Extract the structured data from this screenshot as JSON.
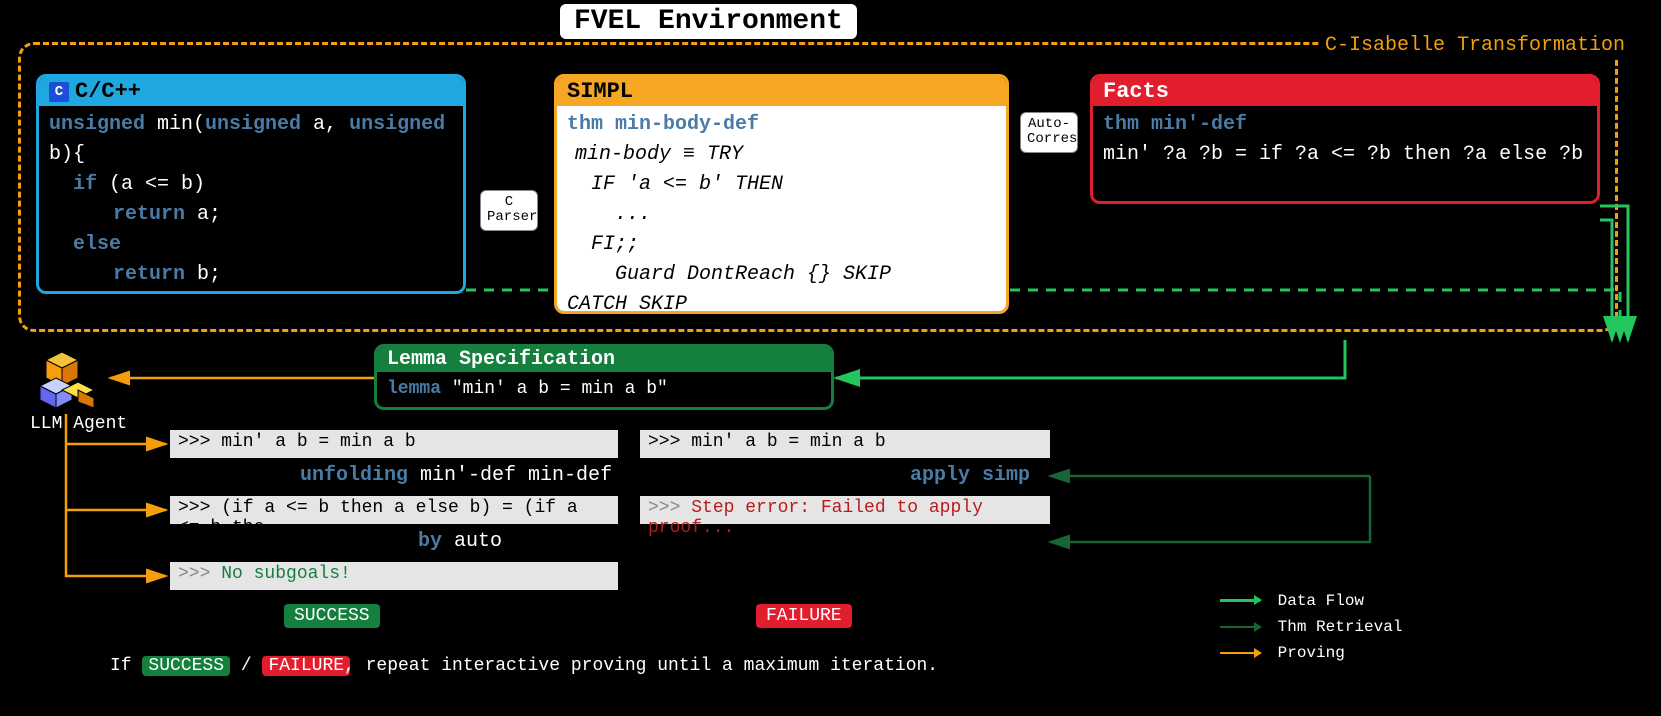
{
  "title": "FVEL Environment",
  "env_label": "C-Isabelle Transformation",
  "panels": {
    "ccpp": {
      "title": "C/C++",
      "line1_lead": "unsigned",
      "line1_sig": " min(",
      "line1_k2": "unsigned",
      "line1_mid": " a, ",
      "line1_k3": "unsigned",
      "line1_end": " b){",
      "line2_kw": "if",
      "line2_rest": " (a <= b)",
      "line3_kw": "return",
      "line3_rest": " a;",
      "line4_kw": "else",
      "line5_kw": "return",
      "line5_rest": " b;"
    },
    "simpl": {
      "title": "SIMPL",
      "line_thm": "thm min-body-def",
      "l1": "min-body ≡ TRY",
      "l2": "IF 'a <= b' THEN",
      "l3": "...",
      "l4": "FI;;",
      "l5": "Guard DontReach {} SKIP",
      "l6": "CATCH SKIP"
    },
    "facts": {
      "title": "Facts",
      "line_thm": "thm min'-def",
      "body": "min' ?a ?b = if ?a <= ?b then ?a else ?b"
    },
    "lemma": {
      "title": "Lemma Specification",
      "kw": "lemma",
      "body": "\"min' a b = min a b\""
    }
  },
  "labels": {
    "parser": "C\nParser",
    "auto": "Auto-\nCorres",
    "llm": "LLM Agent"
  },
  "trace": {
    "left": {
      "r1": ">>> min' a b = min a b",
      "step1": "unfolding",
      "step1_rest": " min'-def min-def",
      "r2": ">>> (if a <= b then a else b) = (if a <= b the...",
      "step2": "by",
      "step2_rest": " auto",
      "r3_prefix": ">>> ",
      "r3_ok": "No subgoals!",
      "badge": "SUCCESS"
    },
    "right": {
      "r1": ">>> min' a b = min a b",
      "step1": "apply simp",
      "r2_prefix": ">>> ",
      "r2_err": "Step error: Failed to apply proof...",
      "badge": "FAILURE"
    }
  },
  "legend": {
    "a": "Data Flow",
    "b": "Thm Retrieval",
    "c": "Proving"
  },
  "footer": {
    "note_lead": "If ",
    "succ": "SUCCESS",
    "fail": "FAILURE",
    "note_tail": ", repeat interactive proving until a maximum iteration."
  }
}
